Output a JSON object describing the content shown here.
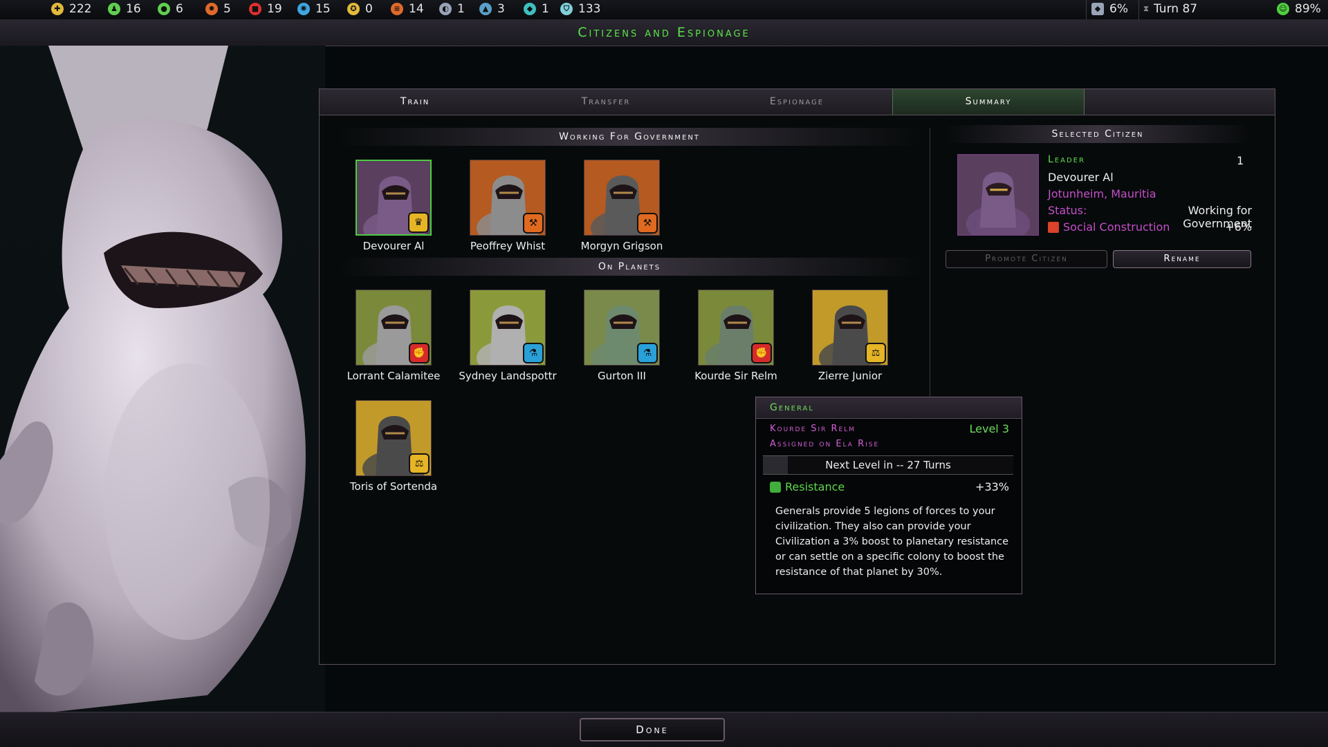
{
  "topbar": {
    "resources": [
      {
        "icon": "credits-icon",
        "value": "222",
        "color": "#e2b93b"
      },
      {
        "icon": "population-icon",
        "value": "16",
        "color": "#5fcf4f"
      },
      {
        "icon": "food-icon",
        "value": "6",
        "color": "#5fcf4f"
      },
      {
        "icon": "industry-icon",
        "value": "5",
        "color": "#e06a2a"
      },
      {
        "icon": "military-icon",
        "value": "19",
        "color": "#e03030"
      },
      {
        "icon": "research-icon",
        "value": "15",
        "color": "#3fa6e0"
      },
      {
        "icon": "influence-icon",
        "value": "0",
        "color": "#e2b93b"
      },
      {
        "icon": "manufacturing-icon",
        "value": "14",
        "color": "#e06a2a"
      },
      {
        "icon": "elerium-icon",
        "value": "1",
        "color": "#9aa4b8"
      },
      {
        "icon": "durantium-icon",
        "value": "3",
        "color": "#5aa0c8"
      },
      {
        "icon": "promethion-icon",
        "value": "1",
        "color": "#3fc0c0"
      },
      {
        "icon": "shield-resource-icon",
        "value": "133",
        "color": "#7fd0d8"
      }
    ],
    "tax": "6%",
    "turn": "Turn 87",
    "approval": "89%"
  },
  "title": "Citizens and Espionage",
  "tabs": {
    "train": "Train",
    "transfer": "Transfer",
    "espionage": "Espionage",
    "summary": "Summary"
  },
  "sections": {
    "government": "Working For Government",
    "planets": "On Planets",
    "selected": "Selected Citizen"
  },
  "citizens_gov": [
    {
      "name": "Devourer Al",
      "badge": "crown-icon",
      "badge_color": "#e6b526",
      "body": "#7a5a86",
      "bg": "#5a3f5e",
      "selected": true
    },
    {
      "name": "Peoffrey Whist",
      "badge": "worker-icon",
      "badge_color": "#e06a20",
      "body": "#8c8c8c",
      "bg": "#b55a20",
      "selected": false
    },
    {
      "name": "Morgyn Grigson",
      "badge": "worker-icon",
      "badge_color": "#e06a20",
      "body": "#5a5a5a",
      "bg": "#b55a20",
      "selected": false
    }
  ],
  "citizens_planets": [
    {
      "name": "Lorrant Calamitee",
      "badge": "fist-icon",
      "badge_color": "#d62a2a",
      "body": "#9a9a9a",
      "bg": "#7a8a3a"
    },
    {
      "name": "Sydney Landspottr",
      "badge": "flask-icon",
      "badge_color": "#2aa0d8",
      "body": "#b0b0b0",
      "bg": "#8a9a3a"
    },
    {
      "name": "Gurton III",
      "badge": "flask-icon",
      "badge_color": "#2aa0d8",
      "body": "#6e8a6e",
      "bg": "#7a8a4a"
    },
    {
      "name": "Kourde Sir Relm",
      "badge": "fist-icon",
      "badge_color": "#d62a2a",
      "body": "#6a7e6a",
      "bg": "#7a8a3a"
    },
    {
      "name": "Zierre Junior",
      "badge": "scales-icon",
      "badge_color": "#e6b526",
      "body": "#4a4a4a",
      "bg": "#c29a2a"
    },
    {
      "name": "Toris of Sortenda",
      "badge": "scales-icon",
      "badge_color": "#e6b526",
      "body": "#4a4a4a",
      "bg": "#c29a2a"
    }
  ],
  "selected": {
    "role": "Leader",
    "level": "1",
    "name": "Devourer Al",
    "location": "Jotunheim, Mauritia",
    "status_label": "Status:",
    "status_value": "Working for Government",
    "bonus_label": "Social Construction",
    "bonus_value": "+6%",
    "promote": "Promote Citizen",
    "rename": "Rename"
  },
  "tooltip": {
    "title": "General",
    "name": "Kourde Sir Relm",
    "assigned": "Assigned on Ela Rise",
    "level": "Level 3",
    "next_level": "Next Level in -- 27 Turns",
    "progress": 0.1,
    "stat_label": "Resistance",
    "stat_value": "+33%",
    "description": "Generals provide 5 legions of forces to your civilization. They also can provide your Civilization a 3% boost to planetary resistance or can settle on a specific colony to boost the resistance of that planet by 30%."
  },
  "done": "Done"
}
